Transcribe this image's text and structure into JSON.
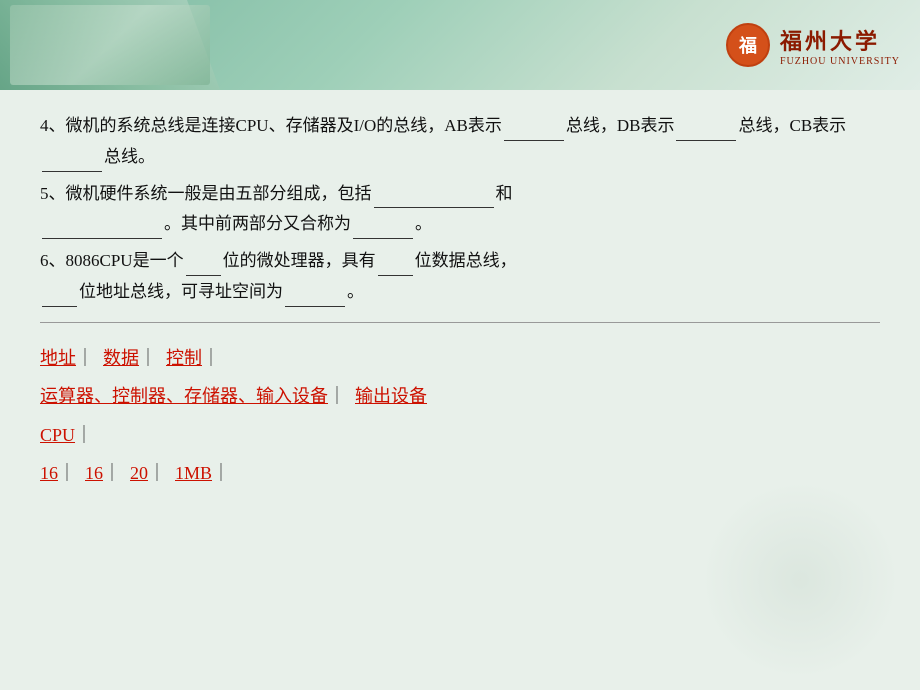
{
  "header": {
    "logo_circle_char": "福",
    "logo_chinese": "福州大学",
    "logo_english": "FUZHOU UNIVERSITY"
  },
  "questions": [
    {
      "number": "4",
      "text_before_blank1": "、微机的系统总线是连接CPU、存储器及I/O的总线，AB表示",
      "blank1_label": "地址",
      "text_mid1": "总线，DB表示",
      "blank2_label": "数据",
      "text_mid2": "总线，CB表示",
      "blank3_label": "控制",
      "text_end": "总线。"
    },
    {
      "number": "5",
      "text_before_blank1": "、微机硬件系统一般是由五部分组成，包括",
      "blank1_label": "运算器、控制器、存储器、输入设备",
      "text_mid1": "和",
      "blank2_label": "输出设备",
      "text_mid2": "。其中前两部分又合称为",
      "blank3_label": "CPU",
      "text_end": "。"
    },
    {
      "number": "6",
      "text_before_blank1": "、8086CPU是一个",
      "blank1_label": "16",
      "text_mid1": "位的微处理器，具有",
      "blank2_label": "16",
      "text_mid2": "位数据总线，",
      "blank3_label": "20",
      "text_mid3": "位地址总线，可寻址空间为",
      "blank4_label": "1MB",
      "text_end": "。"
    }
  ],
  "answers": {
    "row1": {
      "label1": "地址",
      "sep1": "｜",
      "label2": "数据",
      "sep2": "｜",
      "label3": "控制",
      "sep3": "｜"
    },
    "row2": {
      "label1": "运算器、控制器、存储器、输入设备",
      "sep1": "｜",
      "label2": "输出设备"
    },
    "row3": {
      "label1": "CPU",
      "sep1": "｜"
    },
    "row4": {
      "label1": "16",
      "sep1": "｜",
      "label2": "16",
      "sep2": "｜",
      "label3": "20",
      "sep3": "｜",
      "label4": "1MB",
      "sep4": "｜"
    }
  }
}
